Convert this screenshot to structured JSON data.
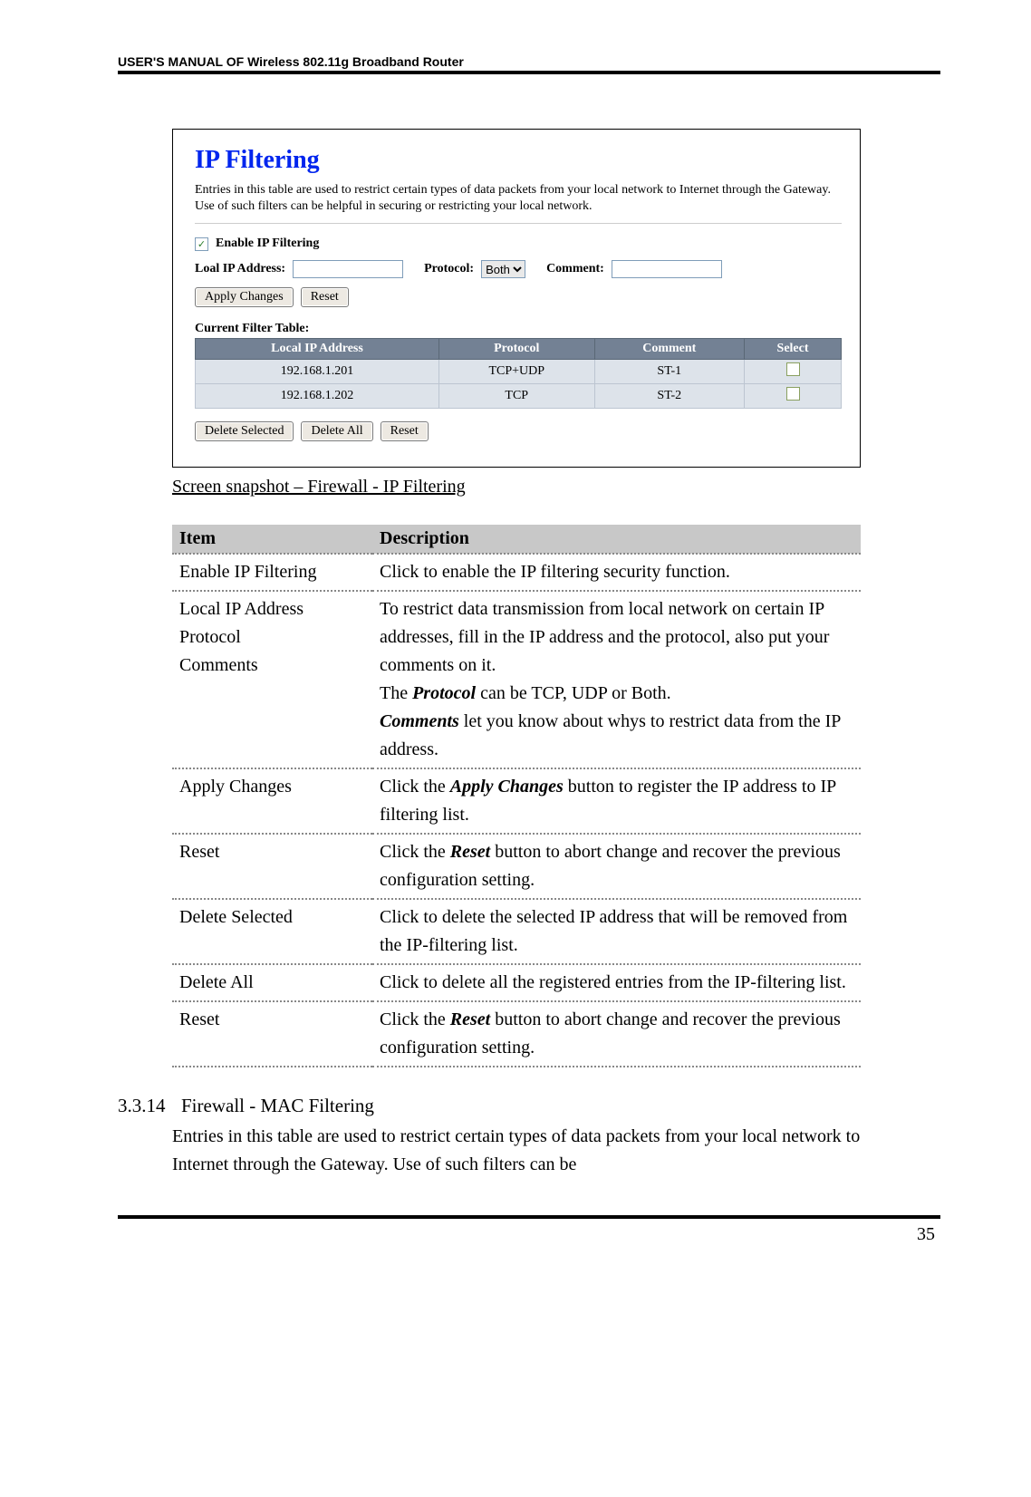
{
  "header": "USER'S MANUAL OF Wireless 802.11g Broadband Router",
  "screenshot": {
    "title": "IP Filtering",
    "description": "Entries in this table are used to restrict certain types of data packets from your local network to Internet through the Gateway. Use of such filters can be helpful in securing or restricting your local network.",
    "enable_label": "Enable IP Filtering",
    "local_ip_label": "Loal IP Address:",
    "protocol_label": "Protocol:",
    "protocol_value": "Both",
    "comment_label": "Comment:",
    "apply_btn": "Apply Changes",
    "reset_btn": "Reset",
    "current_filter_label": "Current Filter Table:",
    "table": {
      "headers": [
        "Local IP Address",
        "Protocol",
        "Comment",
        "Select"
      ],
      "rows": [
        [
          "192.168.1.201",
          "TCP+UDP",
          "ST-1"
        ],
        [
          "192.168.1.202",
          "TCP",
          "ST-2"
        ]
      ]
    },
    "delete_selected_btn": "Delete Selected",
    "delete_all_btn": "Delete All",
    "reset2_btn": "Reset"
  },
  "caption": "Screen snapshot – Firewall - IP Filtering",
  "desc_table": {
    "item_hdr": "Item",
    "desc_hdr": "Description",
    "rows": {
      "enable": {
        "item": "Enable IP Filtering",
        "desc": "Click to enable the IP filtering security function."
      },
      "localgroup": {
        "items": [
          "Local IP Address",
          "Protocol",
          "Comments"
        ],
        "desc_plain1": "To restrict data transmission from local network on certain IP addresses, fill in the IP address and the protocol, also put your comments on it.",
        "desc_line2_pre": "The ",
        "desc_line2_bi": "Protocol",
        "desc_line2_post": " can be TCP, UDP or Both.",
        "desc_line3_bi": "Comments",
        "desc_line3_post": " let you know about whys to restrict data from the IP address."
      },
      "apply": {
        "item": "Apply Changes",
        "pre": "Click the ",
        "bi": "Apply Changes",
        "post": " button to register the IP address to IP filtering list."
      },
      "reset1": {
        "item": "Reset",
        "pre": "Click the ",
        "bi": "Reset",
        "post": " button to abort change and recover the previous configuration setting."
      },
      "delsel": {
        "item": "Delete Selected",
        "desc": "Click to delete the selected IP address that will be removed from the IP-filtering list."
      },
      "delall": {
        "item": "Delete All",
        "desc": "Click to delete all the registered entries from the IP-filtering list."
      },
      "reset2": {
        "item": "Reset",
        "pre": "Click the ",
        "bi": "Reset",
        "post": " button to abort change and recover the previous configuration setting."
      }
    }
  },
  "next_section": {
    "number": "3.3.14",
    "title": "Firewall - MAC Filtering",
    "body": "Entries in this table are used to restrict certain types of data packets from your local network to Internet through the Gateway. Use of such filters can be"
  },
  "page_number": "35"
}
